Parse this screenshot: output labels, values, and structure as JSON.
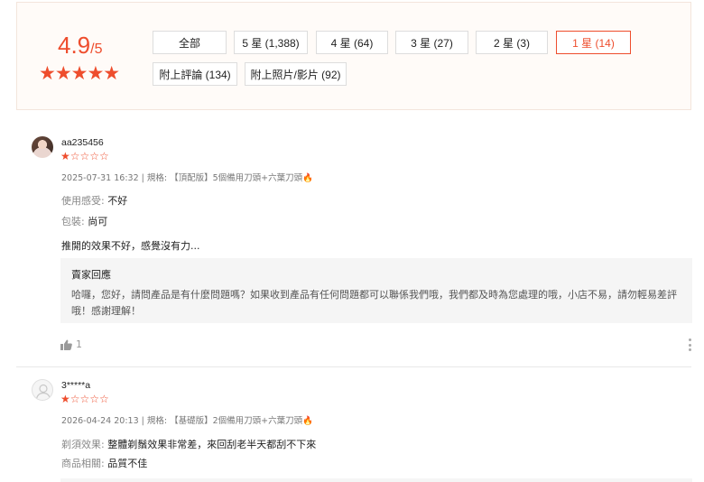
{
  "summary": {
    "score": "4.9",
    "score_suffix": "/5",
    "stars": "★★★★★"
  },
  "filters": [
    {
      "label": "全部",
      "active": false
    },
    {
      "label": "5 星 (1,388)",
      "active": false
    },
    {
      "label": "4 星 (64)",
      "active": false
    },
    {
      "label": "3 星 (27)",
      "active": false
    },
    {
      "label": "2 星 (3)",
      "active": false
    },
    {
      "label": "1 星 (14)",
      "active": true
    },
    {
      "label": "附上評論 (134)",
      "active": false
    },
    {
      "label": "附上照片/影片 (92)",
      "active": false
    }
  ],
  "reviews": [
    {
      "username": "aa235456",
      "rating_stars": "★☆☆☆☆",
      "meta": "2025-07-31 16:32 | 規格: 【頂配版】5個備用刀頭+六葉刀頭",
      "attributes": [
        {
          "key": "使用感受:",
          "value": "不好"
        },
        {
          "key": "包裝:",
          "value": "尚可"
        }
      ],
      "text": "推開的效果不好，感覺沒有力...",
      "reply_title": "賣家回應",
      "reply_text": "哈囉，您好，請問產品是有什麼問題嗎？如果收到產品有任何問題都可以聯係我們哦，我們都及時為您處理的哦，小店不易，請勿輕易差評哦！感謝理解！",
      "likes": "1"
    },
    {
      "username": "3*****a",
      "rating_stars": "★☆☆☆☆",
      "meta": "2026-04-24 20:13 | 規格: 【基礎版】2個備用刀頭+六葉刀頭",
      "attributes": [
        {
          "key": "剃須效果:",
          "value": "整體剃鬚效果非常差，來回刮老半天都刮不下來"
        },
        {
          "key": "商品相關:",
          "value": "品質不佳"
        }
      ]
    }
  ],
  "icons": {
    "flame": "🔥",
    "thumb": "thumb-up-icon",
    "more": "more-vertical-icon"
  },
  "colors": {
    "accent": "#ee4d2d",
    "summary_bg": "#fffbf8",
    "reply_bg": "#f5f5f5"
  }
}
